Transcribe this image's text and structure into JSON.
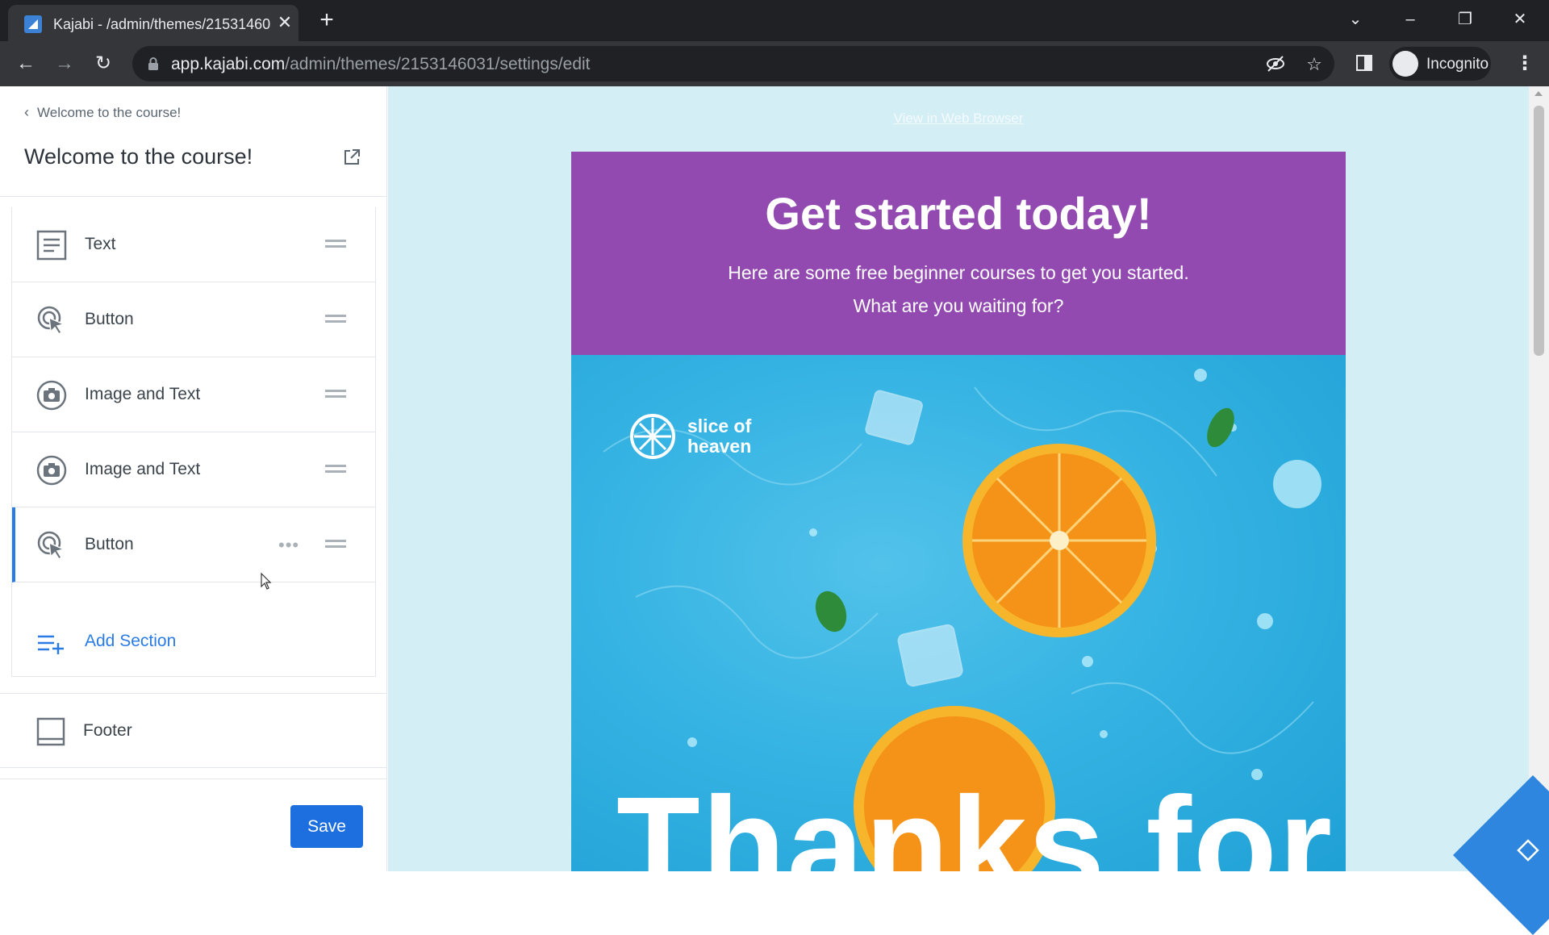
{
  "browser": {
    "tab_title": "Kajabi - /admin/themes/2153146031/settings/edit",
    "new_tab": "+",
    "close": "✕",
    "url_host": "app.kajabi.com",
    "url_path": "/admin/themes/2153146031/settings/edit",
    "profile_label": "Incognito"
  },
  "panel": {
    "back_label": "Welcome to the course!",
    "title": "Welcome to the course!",
    "sections": [
      {
        "label": "Text",
        "icon": "text-icon"
      },
      {
        "label": "Button",
        "icon": "cursor-click-icon"
      },
      {
        "label": "Image and Text",
        "icon": "camera-icon"
      },
      {
        "label": "Image and Text",
        "icon": "camera-icon"
      },
      {
        "label": "Button",
        "icon": "cursor-click-icon",
        "active": true,
        "more": "•••"
      }
    ],
    "add_section_label": "Add Section",
    "footer_label": "Footer",
    "save_label": "Save"
  },
  "preview": {
    "view_in_browser": "View in Web Browser",
    "hero_title": "Get started today!",
    "hero_subtitle": "Here are some free beginner courses to get you started. What are you waiting for?",
    "brand_line1": "slice of",
    "brand_line2": "heaven",
    "big_text": "Thanks for"
  },
  "colors": {
    "accent": "#1d6fe0",
    "hero_bg": "#924ab1",
    "preview_bg": "#d4eef6"
  }
}
